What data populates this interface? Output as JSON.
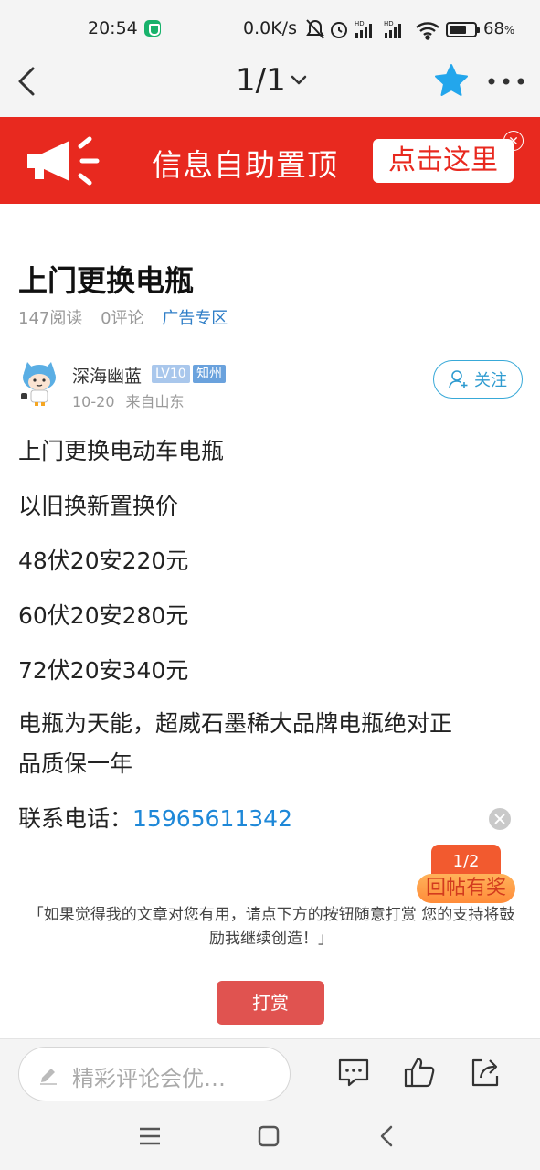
{
  "status_bar": {
    "time": "20:54",
    "network_speed": "0.0K/s",
    "battery_percent": "68",
    "battery_unit": "%",
    "battery_level": 0.68,
    "icons": [
      "shield-app-icon",
      "mute-bell-icon",
      "alarm-icon",
      "hd-signal-icon",
      "hd-signal-icon",
      "wifi-icon",
      "battery-icon"
    ]
  },
  "header": {
    "page_indicator": "1/1",
    "back_icon": "chevron-left-icon",
    "favorite_icon": "star-icon",
    "more_icon": "ellipsis-icon"
  },
  "ad_banner": {
    "text": "信息自助置顶",
    "button_label": "点击这里",
    "icon": "megaphone-icon"
  },
  "article": {
    "title": "上门更换电瓶",
    "reads": "147阅读",
    "comments": "0评论",
    "category": "广告专区",
    "author": {
      "name": "深海幽蓝",
      "level": "LV10",
      "location_badge": "知州",
      "date": "10-20",
      "origin": "来自山东"
    },
    "follow_label": "关注",
    "body": [
      "上门更换电动车电瓶",
      "以旧换新置换价",
      "48伏20安220元",
      "60伏20安280元",
      "72伏20安340元",
      "电瓶为天能，超威石墨稀大品牌电瓶绝对正",
      "品质保一年"
    ],
    "contact_label": "联系电话：",
    "contact_phone": "15965611342"
  },
  "reward_float": {
    "page": "1/2",
    "label": "回帖有奖"
  },
  "reward": {
    "tip": "「如果觉得我的文章对您有用，请点下方的按钮随意打赏 您的支持将鼓励我继续创造！」",
    "button_label": "打赏"
  },
  "comment_bar": {
    "placeholder": "精彩评论会优…"
  },
  "colors": {
    "ad_red": "#e8291f",
    "link_blue": "#2f7ec7",
    "reward_red": "#e05350",
    "star_blue": "#23a6ec"
  }
}
